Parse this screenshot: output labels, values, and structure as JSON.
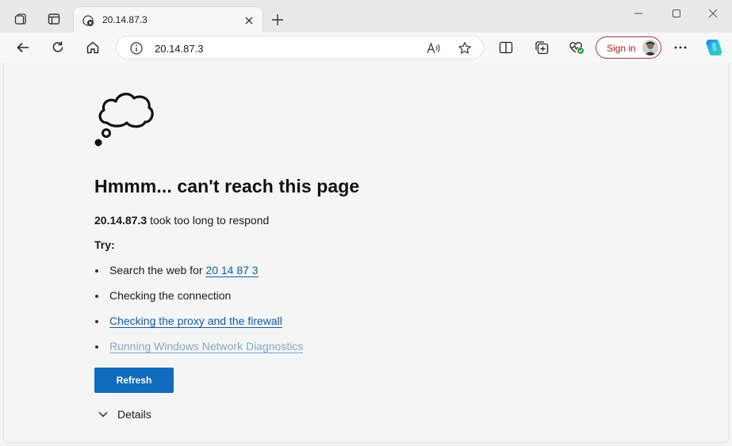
{
  "tab": {
    "title": "20.14.87.3"
  },
  "address_bar": {
    "url": "20.14.87.3"
  },
  "toolbar": {
    "sign_in_label": "Sign in"
  },
  "error_page": {
    "heading": "Hmmm... can't reach this page",
    "host": "20.14.87.3",
    "message": "took too long to respond",
    "try_label": "Try:",
    "suggestions": [
      {
        "text": "Search the web for ",
        "link": "20 14 87 3"
      },
      {
        "text": "Checking the connection"
      },
      {
        "link": "Checking the proxy and the firewall"
      },
      {
        "link": "Running Windows Network Diagnostics"
      }
    ],
    "refresh_label": "Refresh",
    "details_label": "Details"
  },
  "colors": {
    "accent": "#0f6cbd",
    "link": "#0f5ea8",
    "signin_border": "#a33a3a"
  },
  "icons": [
    "workspaces-icon",
    "tab-actions-icon",
    "error-favicon-icon",
    "close-icon",
    "plus-icon",
    "minimize-icon",
    "maximize-icon",
    "window-close-icon",
    "back-arrow-icon",
    "reload-icon",
    "home-icon",
    "info-icon",
    "read-aloud-icon",
    "favorite-star-icon",
    "split-screen-icon",
    "collections-icon",
    "browser-essentials-icon",
    "more-icon",
    "copilot-icon",
    "thought-cloud-icon",
    "chevron-down-icon"
  ]
}
